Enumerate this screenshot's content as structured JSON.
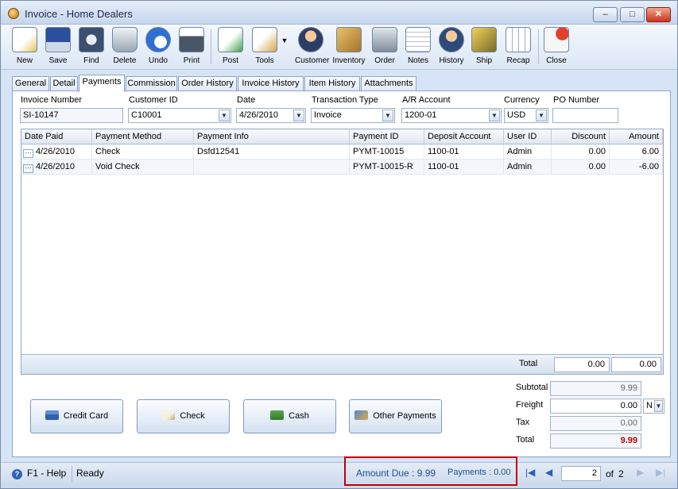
{
  "window": {
    "title": "Invoice - Home Dealers",
    "min_glyph": "–",
    "max_glyph": "□",
    "close_glyph": "✕"
  },
  "toolbar": [
    {
      "label": "New",
      "icon": "new-icon"
    },
    {
      "label": "Save",
      "icon": "save-icon"
    },
    {
      "label": "Find",
      "icon": "find-icon"
    },
    {
      "label": "Delete",
      "icon": "delete-icon"
    },
    {
      "label": "Undo",
      "icon": "undo-icon"
    },
    {
      "label": "Print",
      "icon": "print-icon"
    },
    {
      "label": "Post",
      "icon": "post-icon"
    },
    {
      "label": "Tools",
      "icon": "tools-icon"
    },
    {
      "label": "Customer",
      "icon": "customer-icon"
    },
    {
      "label": "Inventory",
      "icon": "inventory-icon"
    },
    {
      "label": "Order",
      "icon": "order-icon"
    },
    {
      "label": "Notes",
      "icon": "notes-icon"
    },
    {
      "label": "History",
      "icon": "history-icon"
    },
    {
      "label": "Ship",
      "icon": "ship-icon"
    },
    {
      "label": "Recap",
      "icon": "recap-icon"
    },
    {
      "label": "Close",
      "icon": "close-icon"
    }
  ],
  "tabs": [
    "General",
    "Detail",
    "Payments",
    "Commission",
    "Order History",
    "Invoice History",
    "Item History",
    "Attachments"
  ],
  "active_tab": "Payments",
  "header": {
    "invoice_number_label": "Invoice Number",
    "invoice_number": "SI-10147",
    "customer_id_label": "Customer ID",
    "customer_id": "C10001",
    "date_label": "Date",
    "date": "4/26/2010",
    "transaction_type_label": "Transaction Type",
    "transaction_type": "Invoice",
    "ar_account_label": "A/R Account",
    "ar_account": "1200-01",
    "currency_label": "Currency",
    "currency": "USD",
    "po_number_label": "PO Number",
    "po_number": ""
  },
  "grid": {
    "columns": [
      "Date Paid",
      "Payment Method",
      "Payment Info",
      "Payment ID",
      "Deposit Account",
      "User ID",
      "Discount",
      "Amount"
    ],
    "rows": [
      [
        "4/26/2010",
        "Check",
        "Dsfd12541",
        "PYMT-10015",
        "1100-01",
        "Admin",
        "0.00",
        "6.00"
      ],
      [
        "4/26/2010",
        "Void Check",
        "",
        "PYMT-10015-R",
        "1100-01",
        "Admin",
        "0.00",
        "-6.00"
      ]
    ],
    "total_label": "Total",
    "total_discount": "0.00",
    "total_amount": "0.00"
  },
  "payment_buttons": [
    "Credit Card",
    "Check",
    "Cash",
    "Other Payments"
  ],
  "summary": {
    "subtotal_label": "Subtotal",
    "subtotal": "9.99",
    "freight_label": "Freight",
    "freight": "0.00",
    "freight_term": "N",
    "tax_label": "Tax",
    "tax": "0.00",
    "total_label": "Total",
    "total": "9.99"
  },
  "status": {
    "help": "F1 - Help",
    "state": "Ready",
    "amount_due": "Amount Due : 9.99",
    "payments": "Payments : 0.00",
    "page": "2",
    "of": "of",
    "pages": "2"
  },
  "colors": {
    "accent": "#1f4f8f",
    "total_text": "#c00000",
    "highlight_box": "#c00000"
  }
}
